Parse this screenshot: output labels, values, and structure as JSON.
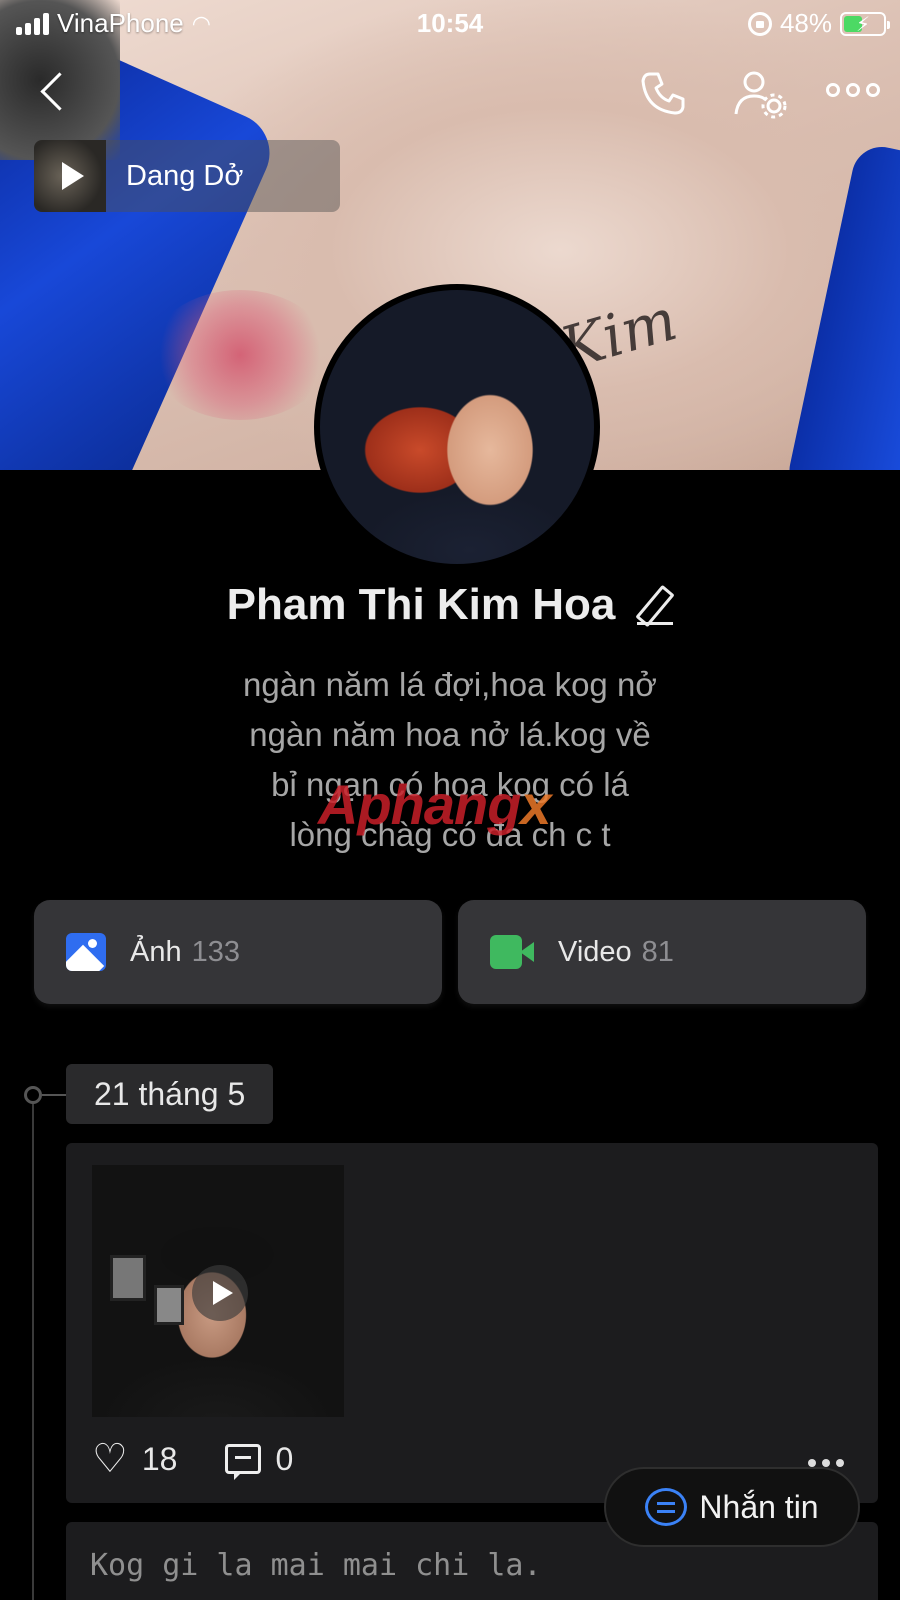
{
  "status_bar": {
    "carrier": "VinaPhone",
    "time": "10:54",
    "battery_percent": "48%",
    "battery_level": 0.48,
    "icons": [
      "signal-icon",
      "wifi-icon",
      "orientation-lock-icon",
      "battery-charging-icon"
    ]
  },
  "nav": {
    "icons": [
      "back-icon",
      "phone-icon",
      "user-settings-icon",
      "more-icon"
    ]
  },
  "music": {
    "song_title": "Dang Dở",
    "icon": "play-icon"
  },
  "profile": {
    "name": "Pham Thi Kim Hoa",
    "bio_lines": [
      "ngàn năm lá đợi,hoa kog nở",
      "ngàn năm hoa nở lá.kog về",
      "bỉ ngạn có hoa kog có lá",
      "lòng chàg có đa ch c t"
    ],
    "watermark": "Aphangx"
  },
  "media": {
    "photos": {
      "label": "Ảnh",
      "count": "133",
      "icon": "photo-icon"
    },
    "videos": {
      "label": "Video",
      "count": "81",
      "icon": "video-icon"
    }
  },
  "timeline": {
    "date": "21 tháng 5",
    "post": {
      "likes": "18",
      "comments": "0"
    },
    "next_post_text": "Kog gi la mai mai chi la."
  },
  "message_button": {
    "label": "Nhắn tin",
    "icon": "chat-icon"
  },
  "colors": {
    "photo_icon": "#2f6df0",
    "video_icon": "#3fb95f",
    "chat_icon": "#3b82f6",
    "battery_fill": "#4cd964"
  }
}
